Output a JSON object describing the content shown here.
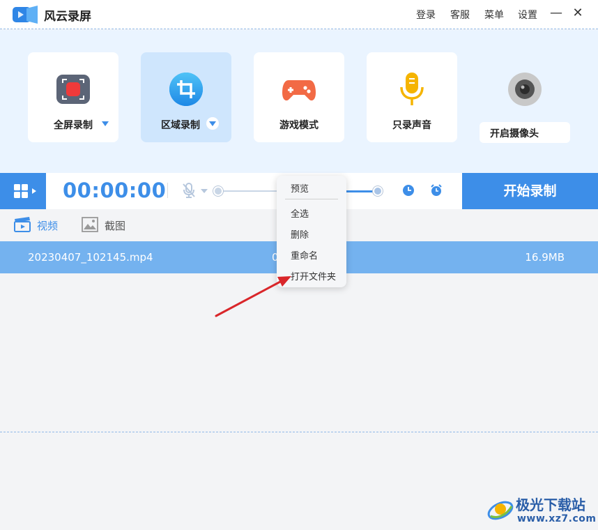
{
  "app": {
    "title": "风云录屏"
  },
  "titlebar": {
    "menu": [
      "登录",
      "客服",
      "菜单",
      "设置"
    ],
    "minimize": "—",
    "close": "✕"
  },
  "modes": [
    {
      "label": "全屏录制",
      "icon": "fullscreen-record-icon",
      "has_dropdown": true,
      "active": false
    },
    {
      "label": "区域录制",
      "icon": "crop-icon",
      "has_dropdown": true,
      "active": true
    },
    {
      "label": "游戏模式",
      "icon": "gamepad-icon",
      "has_dropdown": false,
      "active": false
    },
    {
      "label": "只录声音",
      "icon": "microphone-icon",
      "has_dropdown": false,
      "active": false
    }
  ],
  "camera": {
    "label": "开启摄像头",
    "icon": "webcam-icon"
  },
  "toolbar": {
    "timer": "00:00:00",
    "start_label": "开始录制"
  },
  "tabs": [
    {
      "label": "视频",
      "icon": "video-clapper-icon",
      "active": true
    },
    {
      "label": "截图",
      "icon": "image-icon",
      "active": false
    }
  ],
  "files": [
    {
      "name": "20230407_102145.mp4",
      "duration": "0",
      "size": "16.9MB",
      "selected": true
    }
  ],
  "context_menu": {
    "items": [
      "预览",
      "全选",
      "删除",
      "重命名",
      "打开文件夹"
    ]
  },
  "colors": {
    "accent": "#3d8ee8",
    "selected_row": "#74b2ef",
    "panel_bg": "#eaf4ff"
  },
  "watermark": {
    "title": "极光下载站",
    "url": "www.xz7.com"
  }
}
